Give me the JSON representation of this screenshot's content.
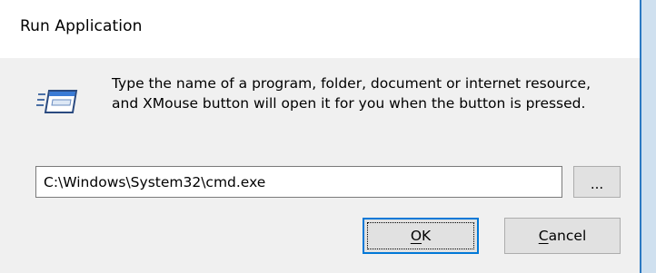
{
  "window": {
    "title": "Run Application"
  },
  "dialog": {
    "icon": "run-window-icon",
    "message": "Type the name of a program, folder, document or internet resource, and XMouse button will open it for you when the button is pressed.",
    "path_value": "C:\\Windows\\System32\\cmd.exe",
    "browse_label": "...",
    "ok_label": "OK",
    "cancel_label": "Cancel"
  },
  "colors": {
    "accent": "#0078d7",
    "window_border": "#2b79c2",
    "dialog_background": "#f0f0f0"
  }
}
